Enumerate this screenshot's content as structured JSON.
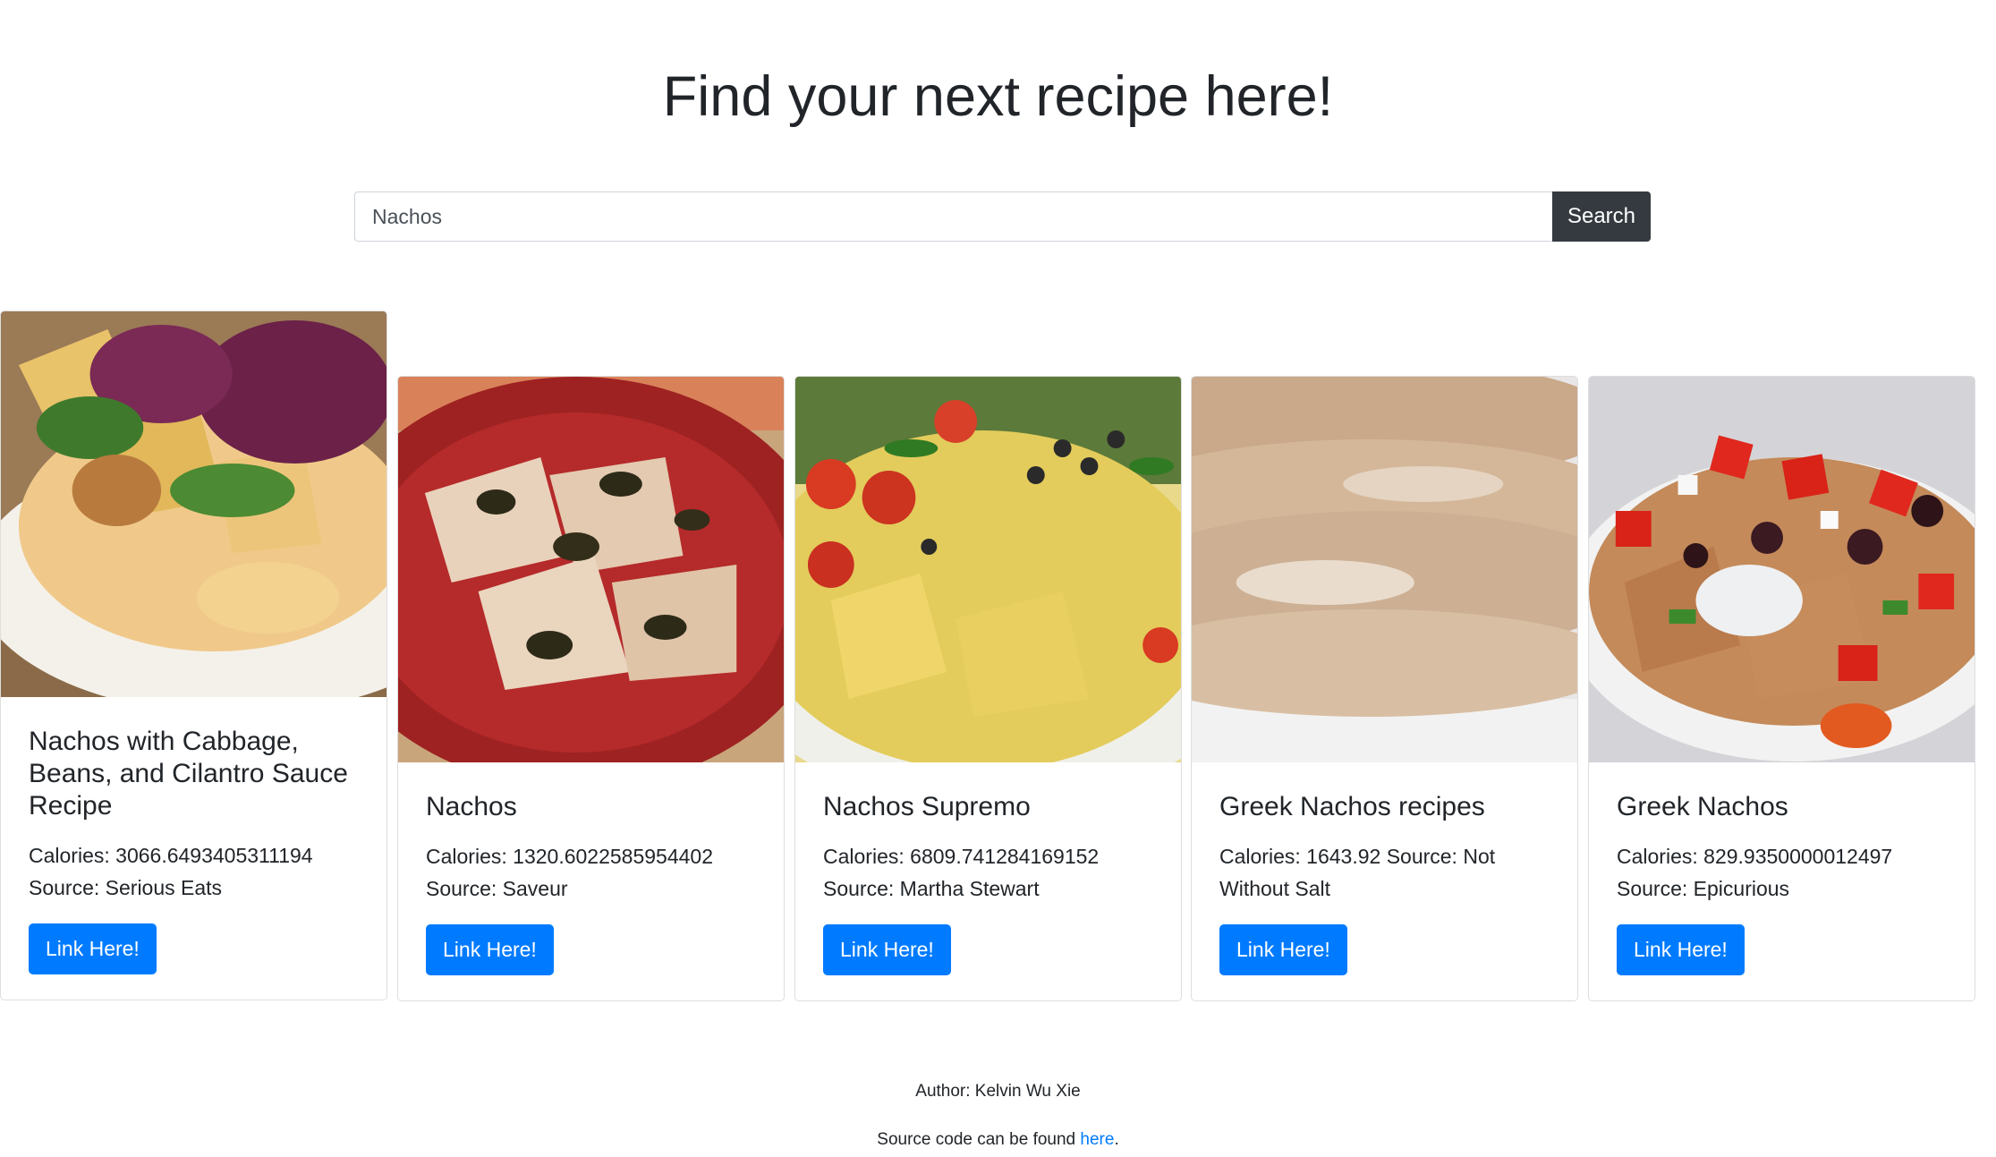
{
  "header": {
    "title": "Find your next recipe here!"
  },
  "search": {
    "value": "Nachos",
    "placeholder": "",
    "button_label": "Search"
  },
  "cards": [
    {
      "title": "Nachos with Cabbage, Beans, and Cilantro Sauce Recipe",
      "calories_label": "Calories:",
      "calories": "3066.6493405311194",
      "source_label": "Source:",
      "source": "Serious Eats",
      "button_label": "Link Here!"
    },
    {
      "title": "Nachos",
      "calories_label": "Calories:",
      "calories": "1320.6022585954402",
      "source_label": "Source:",
      "source": "Saveur",
      "button_label": "Link Here!"
    },
    {
      "title": "Nachos Supremo",
      "calories_label": "Calories:",
      "calories": "6809.741284169152",
      "source_label": "Source:",
      "source": "Martha Stewart",
      "button_label": "Link Here!"
    },
    {
      "title": "Greek Nachos recipes",
      "calories_label": "Calories:",
      "calories": "1643.92",
      "source_label": "Source:",
      "source": "Not Without Salt",
      "button_label": "Link Here!"
    },
    {
      "title": "Greek Nachos",
      "calories_label": "Calories:",
      "calories": "829.9350000012497",
      "source_label": "Source:",
      "source": "Epicurious",
      "button_label": "Link Here!"
    }
  ],
  "footer": {
    "author": "Author: Kelvin Wu Xie",
    "source_prefix": "Source code can be found",
    "source_link": "here",
    "source_suffix": "."
  },
  "colors": {
    "primary": "#007bff",
    "dark": "#343a40",
    "text": "#212529",
    "link": "#007bff"
  }
}
